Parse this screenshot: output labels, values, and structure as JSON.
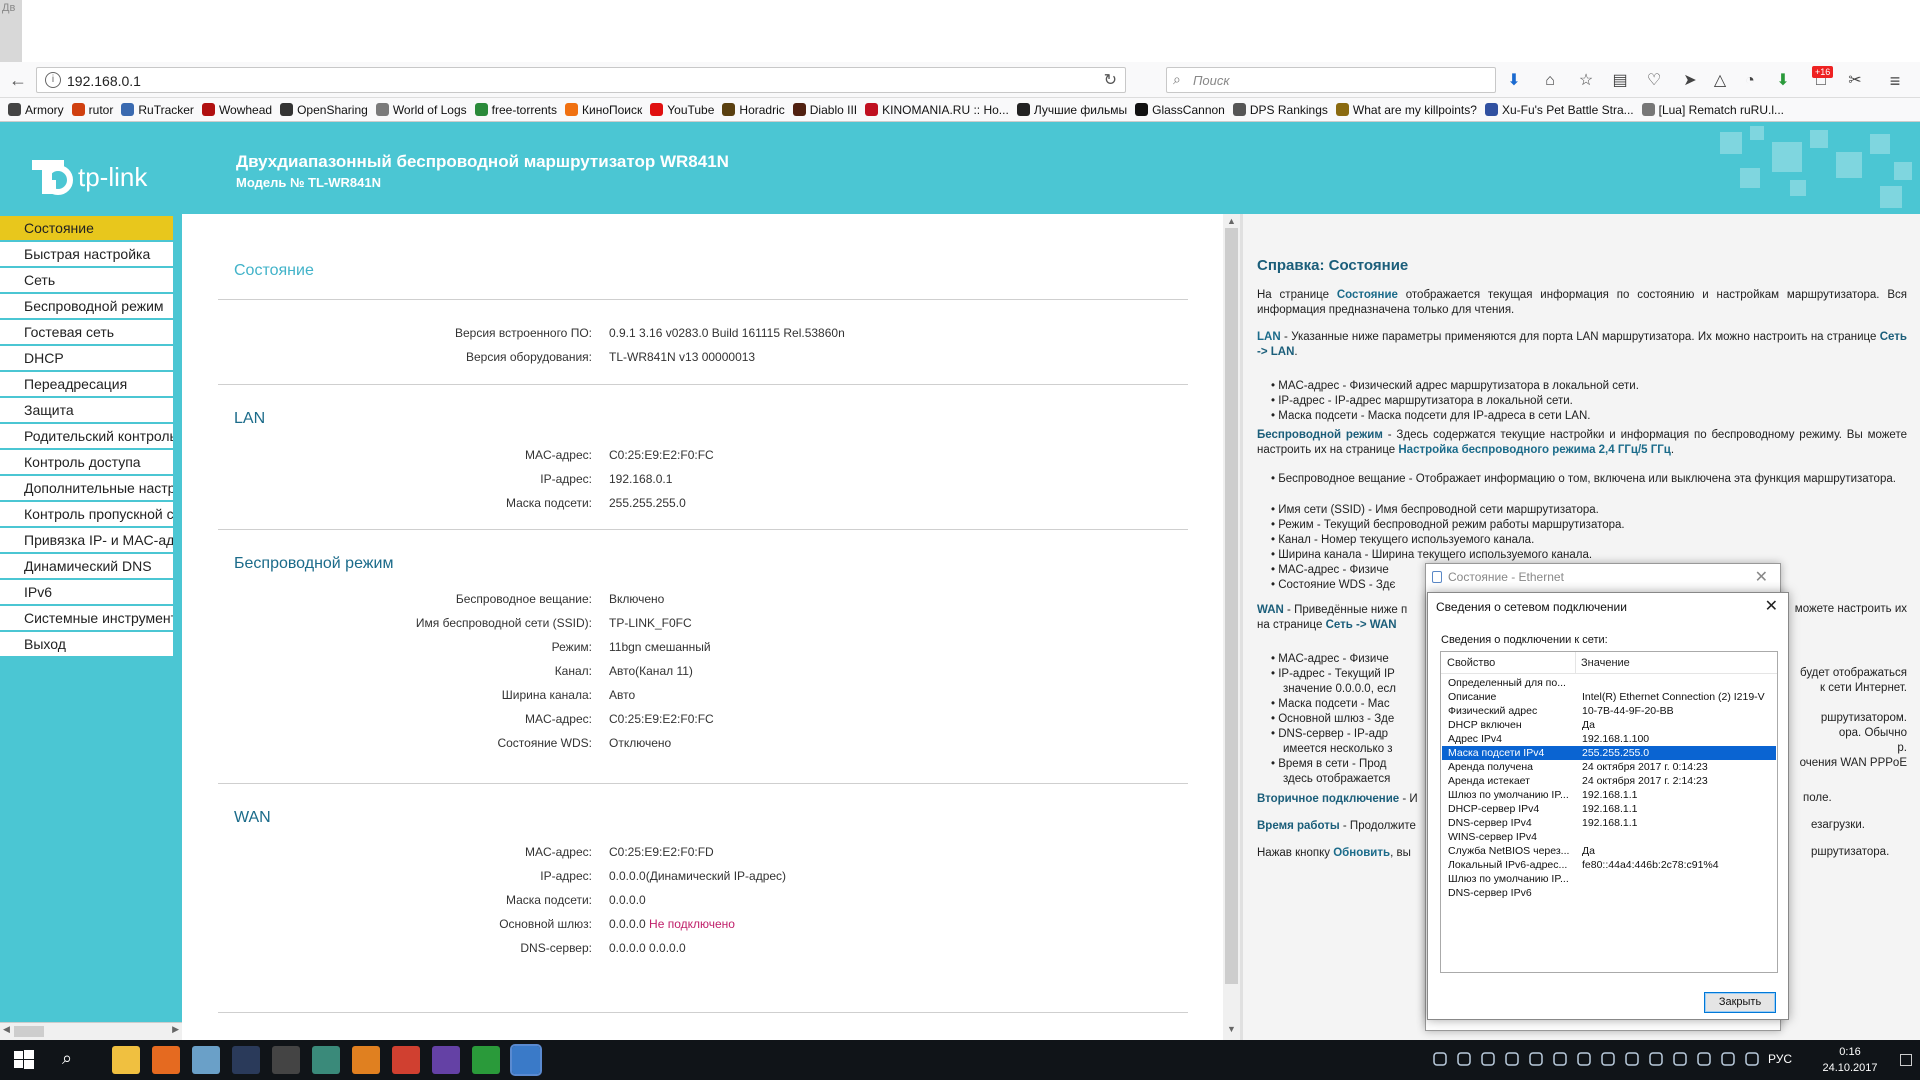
{
  "browser": {
    "tab_fragment": "Дв",
    "url": "192.168.0.1",
    "search_placeholder": "Поиск",
    "badge_count": "+16",
    "bookmarks": [
      {
        "label": "Armory",
        "color": "#444"
      },
      {
        "label": "rutor",
        "color": "#d04010"
      },
      {
        "label": "RuTracker",
        "color": "#3a6ab0"
      },
      {
        "label": "Wowhead",
        "color": "#b01010"
      },
      {
        "label": "OpenSharing",
        "color": "#333"
      },
      {
        "label": "World of Logs",
        "color": "#7a7a7a"
      },
      {
        "label": "free-torrents",
        "color": "#2a8a3a"
      },
      {
        "label": "КиноПоиск",
        "color": "#f07010"
      },
      {
        "label": "YouTube",
        "color": "#e01010"
      },
      {
        "label": "Horadric",
        "color": "#5a4010"
      },
      {
        "label": "Diablo III",
        "color": "#502010"
      },
      {
        "label": "KINOMANIA.RU :: Ho...",
        "color": "#c01020"
      },
      {
        "label": "Лучшие фильмы",
        "color": "#222"
      },
      {
        "label": "GlassCannon",
        "color": "#111"
      },
      {
        "label": "DPS Rankings",
        "color": "#555"
      },
      {
        "label": "What are my killpoints?",
        "color": "#8a6a10"
      },
      {
        "label": "Xu-Fu's Pet Battle Stra...",
        "color": "#3050a0"
      },
      {
        "label": "[Lua] Rematch ruRU.l...",
        "color": "#777"
      }
    ]
  },
  "router": {
    "title": "Двухдиапазонный беспроводной маршрутизатор WR841N",
    "model": "Модель № TL-WR841N",
    "logo_text": "tp-link",
    "brand_color": "#4bc6d3",
    "menu": [
      "Состояние",
      "Быстрая настройка",
      "Сеть",
      "Беспроводной режим",
      "Гостевая сеть",
      "DHCP",
      "Переадресация",
      "Защита",
      "Родительский контроль",
      "Контроль доступа",
      "Дополнительные настройки",
      "Контроль пропускной способности",
      "Привязка IP- и MAC-адресов",
      "Динамический DNS",
      "IPv6",
      "Системные инструменты",
      "Выход"
    ],
    "status": {
      "heading": "Состояние",
      "firmware_label": "Версия встроенного ПО:",
      "firmware_value": "0.9.1 3.16 v0283.0 Build 161115 Rel.53860n",
      "hardware_label": "Версия оборудования:",
      "hardware_value": "TL-WR841N v13 00000013"
    },
    "lan": {
      "heading": "LAN",
      "rows": [
        {
          "label": "MAC-адрес:",
          "value": "C0:25:E9:E2:F0:FC"
        },
        {
          "label": "IP-адрес:",
          "value": "192.168.0.1"
        },
        {
          "label": "Маска подсети:",
          "value": "255.255.255.0"
        }
      ]
    },
    "wireless": {
      "heading": "Беспроводной режим",
      "rows": [
        {
          "label": "Беспроводное вещание:",
          "value": "Включено"
        },
        {
          "label": "Имя беспроводной сети (SSID):",
          "value": "TP-LINK_F0FC"
        },
        {
          "label": "Режим:",
          "value": "11bgn смешанный"
        },
        {
          "label": "Канал:",
          "value": "Авто(Канал 11)"
        },
        {
          "label": "Ширина канала:",
          "value": "Авто"
        },
        {
          "label": "MAC-адрес:",
          "value": "C0:25:E9:E2:F0:FC"
        },
        {
          "label": "Состояние WDS:",
          "value": "Отключено"
        }
      ]
    },
    "wan": {
      "heading": "WAN",
      "rows": [
        {
          "label": "MAC-адрес:",
          "value": "C0:25:E9:E2:F0:FD"
        },
        {
          "label": "IP-адрес:",
          "value": "0.0.0.0(Динамический IP-адрес)"
        },
        {
          "label": "Маска подсети:",
          "value": "0.0.0.0"
        },
        {
          "label": "Основной шлюз:",
          "value": "0.0.0.0"
        },
        {
          "label": "DNS-сервер:",
          "value": "0.0.0.0 0.0.0.0"
        }
      ],
      "gateway_status": "Не подключено"
    }
  },
  "help": {
    "heading": "Справка: Состояние",
    "p1_a": "На странице ",
    "p1_b": "Состояние",
    "p1_c": " отображается текущая информация по состоянию и настройкам маршрутизатора. Вся информация предназначена только для чтения.",
    "p2_a": "LAN",
    "p2_b": " - Указанные ниже параметры применяются для порта LAN маршрутизатора. Их можно настроить на странице ",
    "p2_c": "Сеть -> LAN",
    "p2_d": ".",
    "lan_items": [
      "MAC-адрес - Физический адрес маршрутизатора в локальной сети.",
      "IP-адрес - IP-адрес маршрутизатора в локальной сети.",
      "Маска подсети - Маска подсети для IP-адреса в сети LAN."
    ],
    "p3_a": "Беспроводной режим",
    "p3_b": " - Здесь содержатся текущие настройки и информация по беспроводному режиму. Вы можете настроить их на странице ",
    "p3_c": "Настройка беспроводного режима 2,4 ГГц/5 ГГц",
    "p3_d": ".",
    "wl_items": [
      "Беспроводное вещание - Отображает информацию о том, включена или выключена эта функция маршрутизатора.",
      "Имя сети (SSID) - Имя беспроводной сети маршрутизатора.",
      "Режим - Текущий беспроводной режим работы маршрутизатора.",
      "Канал - Номер текущего используемого канала.",
      "Ширина канала - Ширина текущего используемого канала.",
      "MAC-адрес - Физиче",
      "Состояние WDS - Здє"
    ],
    "p4_a": "WAN",
    "p4_b": " - Приведённые ниже п",
    "p4_c": "можете настроить их",
    "p4_d": "на странице ",
    "p4_e": "Сеть -> WAN",
    "wan_items": [
      "MAC-адрес - Физиче",
      "IP-адрес - Текущий IP",
      "значение 0.0.0.0, есл",
      "Маска подсети - Мас",
      "Основной шлюз - Зде",
      "DNS-сервер - IP-адр",
      "имеется несколько з",
      "Время в сети - Прод",
      "здесь отображается"
    ],
    "wan_right": [
      "будет отображаться",
      "к сети Интернет.",
      "ршрутизатором.",
      "ора. Обычно",
      "р.",
      "очения WAN PPPoE"
    ],
    "p5_a": "Вторичное подключение",
    "p5_b": " - И",
    "p5_c": "поле.",
    "p6_a": "Время работы",
    "p6_b": " - Продолжите",
    "p6_c": "езагрузки.",
    "p7_a": "Нажав кнопку ",
    "p7_b": "Обновить",
    "p7_c": ", вы",
    "p7_d": "ршрутизатора."
  },
  "dialog_back": {
    "title": "Состояние - Ethernet"
  },
  "dialog": {
    "title": "Сведения о сетевом подключении",
    "subtitle": "Сведения о подключении к сети:",
    "col_property": "Свойство",
    "col_value": "Значение",
    "rows": [
      {
        "p": "Определенный для по...",
        "v": ""
      },
      {
        "p": "Описание",
        "v": "Intel(R) Ethernet Connection (2) I219-V"
      },
      {
        "p": "Физический адрес",
        "v": "10-7B-44-9F-20-BB"
      },
      {
        "p": "DHCP включен",
        "v": "Да"
      },
      {
        "p": "Адрес IPv4",
        "v": "192.168.1.100"
      },
      {
        "p": "Маска подсети IPv4",
        "v": "255.255.255.0"
      },
      {
        "p": "Аренда получена",
        "v": "24 октября 2017 г. 0:14:23"
      },
      {
        "p": "Аренда истекает",
        "v": "24 октября 2017 г. 2:14:23"
      },
      {
        "p": "Шлюз по умолчанию IP...",
        "v": "192.168.1.1"
      },
      {
        "p": "DHCP-сервер IPv4",
        "v": "192.168.1.1"
      },
      {
        "p": "DNS-сервер IPv4",
        "v": "192.168.1.1"
      },
      {
        "p": "WINS-сервер IPv4",
        "v": ""
      },
      {
        "p": "Служба NetBIOS через...",
        "v": "Да"
      },
      {
        "p": "Локальный IPv6-адрес...",
        "v": "fe80::44a4:446b:2c78:c91%4"
      },
      {
        "p": "Шлюз по умолчанию IP...",
        "v": ""
      },
      {
        "p": "DNS-сервер IPv6",
        "v": ""
      }
    ],
    "selected_index": 5,
    "close_label": "Закрыть"
  },
  "taskbar": {
    "lang": "РУС",
    "time": "0:16",
    "date": "24.10.2017",
    "apps": [
      {
        "name": "file-explorer-icon",
        "color": "#f0c040"
      },
      {
        "name": "firefox-icon",
        "color": "#e56a20"
      },
      {
        "name": "app-icon-3",
        "color": "#6aa0c8"
      },
      {
        "name": "app-icon-4",
        "color": "#2a3a5a"
      },
      {
        "name": "calculator-icon",
        "color": "#444"
      },
      {
        "name": "app-icon-6",
        "color": "#3a8a7a"
      },
      {
        "name": "media-player-icon",
        "color": "#e08020"
      },
      {
        "name": "chrome-icon",
        "color": "#d04030"
      },
      {
        "name": "twitch-icon",
        "color": "#6441a5"
      },
      {
        "name": "utorrent-icon",
        "color": "#2a9a3a"
      },
      {
        "name": "network-app-icon",
        "color": "#3a7ac8"
      }
    ]
  }
}
